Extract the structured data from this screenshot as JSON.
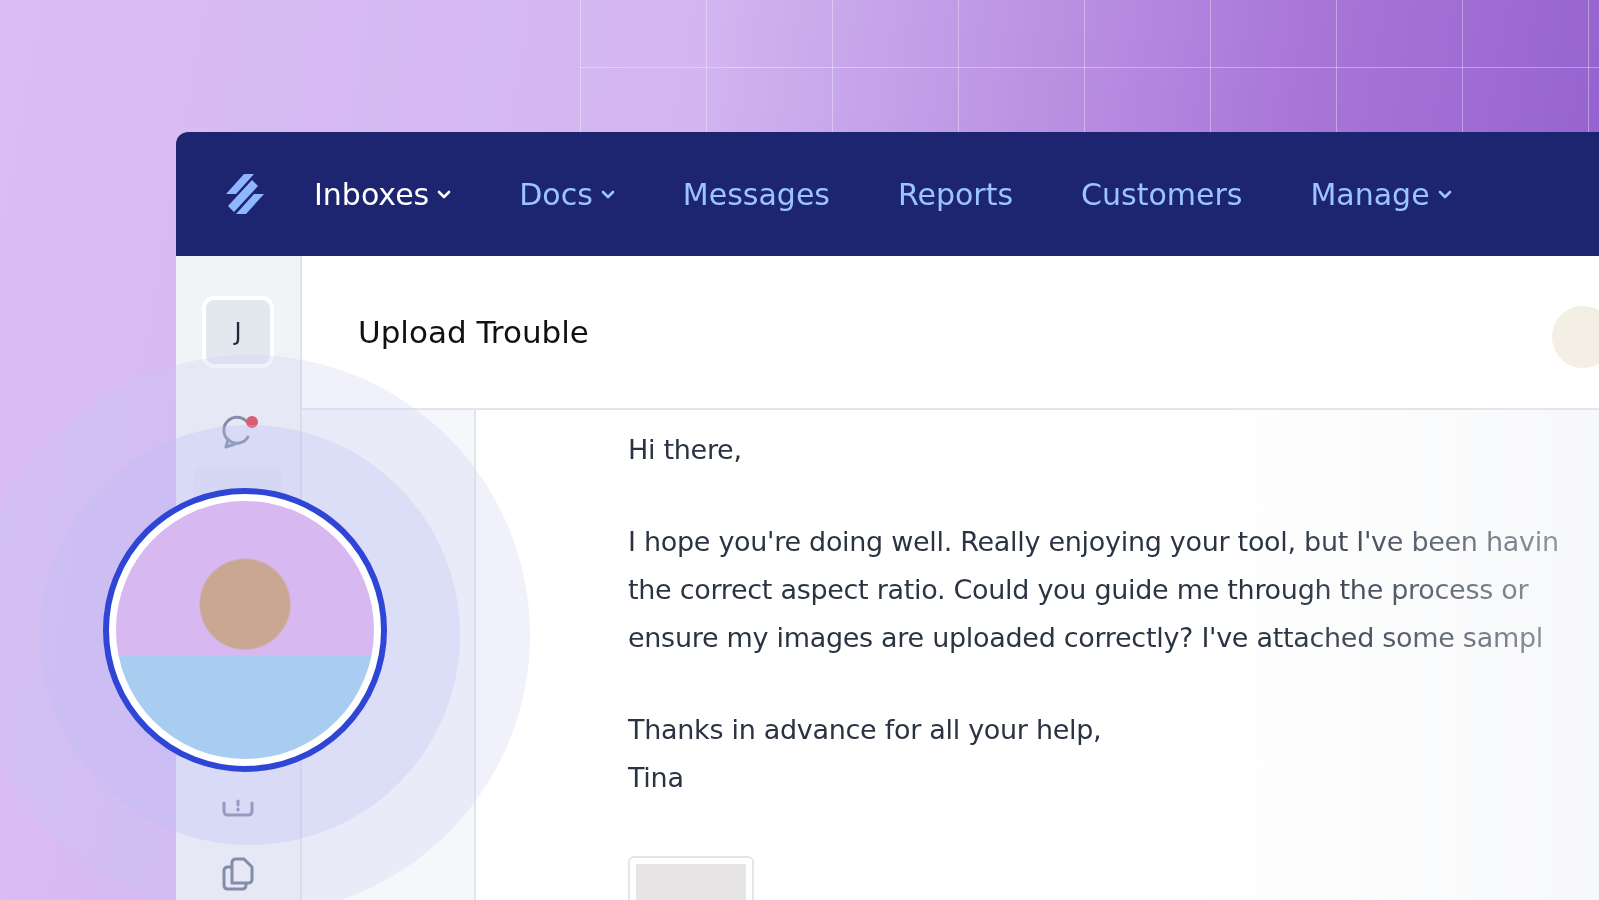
{
  "nav": {
    "items": [
      {
        "label": "Inboxes",
        "selected": true,
        "kind": "menu"
      },
      {
        "label": "Docs",
        "selected": false,
        "kind": "menu"
      },
      {
        "label": "Messages",
        "selected": false,
        "kind": "link"
      },
      {
        "label": "Reports",
        "selected": false,
        "kind": "link"
      },
      {
        "label": "Customers",
        "selected": false,
        "kind": "link"
      },
      {
        "label": "Manage",
        "selected": false,
        "kind": "menu"
      }
    ]
  },
  "sidebar": {
    "user_initial": "J",
    "items": [
      {
        "kind": "chat",
        "unread": true
      },
      {
        "kind": "alert",
        "unread": false
      },
      {
        "kind": "copy",
        "unread": false
      }
    ]
  },
  "conversation": {
    "title": "Upload Trouble",
    "greeting": "Hi there,",
    "body_lines": [
      "I hope you're doing well. Really enjoying your tool, but I've been havin",
      "the correct aspect ratio. Could you guide me through the process or",
      "ensure my images are uploaded correctly? I've attached some sampl"
    ],
    "closing": "Thanks in advance for all your help,",
    "signature": "Tina"
  }
}
